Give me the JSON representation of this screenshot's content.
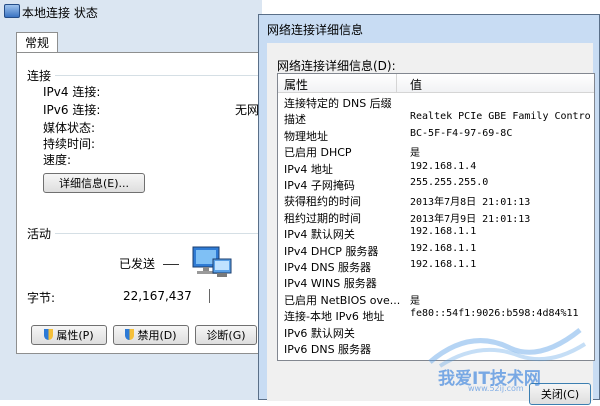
{
  "back_window": {
    "title": "本地连接 状态",
    "tab": "常规",
    "connection_group": "连接",
    "fields": [
      {
        "label": "IPv4 连接:"
      },
      {
        "label": "IPv6 连接:",
        "value": "无网"
      },
      {
        "label": "媒体状态:"
      },
      {
        "label": "持续时间:"
      },
      {
        "label": "速度:"
      }
    ],
    "details_button": "详细信息(E)...",
    "activity_group": "活动",
    "sent_label": "已发送",
    "bytes_label": "字节:",
    "bytes_sent": "22,167,437",
    "buttons": {
      "properties": "属性(P)",
      "disable": "禁用(D)",
      "diagnose": "诊断(G)"
    }
  },
  "front_window": {
    "title": "网络连接详细信息",
    "caption": "网络连接详细信息(D):",
    "columns": {
      "property": "属性",
      "value": "值"
    },
    "rows": [
      {
        "k": "连接特定的 DNS 后缀",
        "v": ""
      },
      {
        "k": "描述",
        "v": "Realtek PCIe GBE Family Contro"
      },
      {
        "k": "物理地址",
        "v": "BC-5F-F4-97-69-8C"
      },
      {
        "k": "已启用 DHCP",
        "v": "是"
      },
      {
        "k": "IPv4 地址",
        "v": "192.168.1.4"
      },
      {
        "k": "IPv4 子网掩码",
        "v": "255.255.255.0"
      },
      {
        "k": "获得租约的时间",
        "v": "2013年7月8日 21:01:13"
      },
      {
        "k": "租约过期的时间",
        "v": "2013年7月9日 21:01:13"
      },
      {
        "k": "IPv4 默认网关",
        "v": "192.168.1.1"
      },
      {
        "k": "IPv4 DHCP 服务器",
        "v": "192.168.1.1"
      },
      {
        "k": "IPv4 DNS 服务器",
        "v": "192.168.1.1"
      },
      {
        "k": "IPv4 WINS 服务器",
        "v": ""
      },
      {
        "k": "已启用 NetBIOS ove...",
        "v": "是"
      },
      {
        "k": "连接-本地 IPv6 地址",
        "v": "fe80::54f1:9026:b598:4d84%11"
      },
      {
        "k": "IPv6 默认网关",
        "v": ""
      },
      {
        "k": "IPv6 DNS 服务器",
        "v": ""
      }
    ],
    "close_button": "关闭(C)"
  },
  "watermark": {
    "text": "我爱IT技术网",
    "url": "www.52ij.com"
  },
  "colors": {
    "window_frame": "#c8dcf3",
    "back_frame": "#dbe6f2",
    "group_line": "#d5dfe5"
  }
}
